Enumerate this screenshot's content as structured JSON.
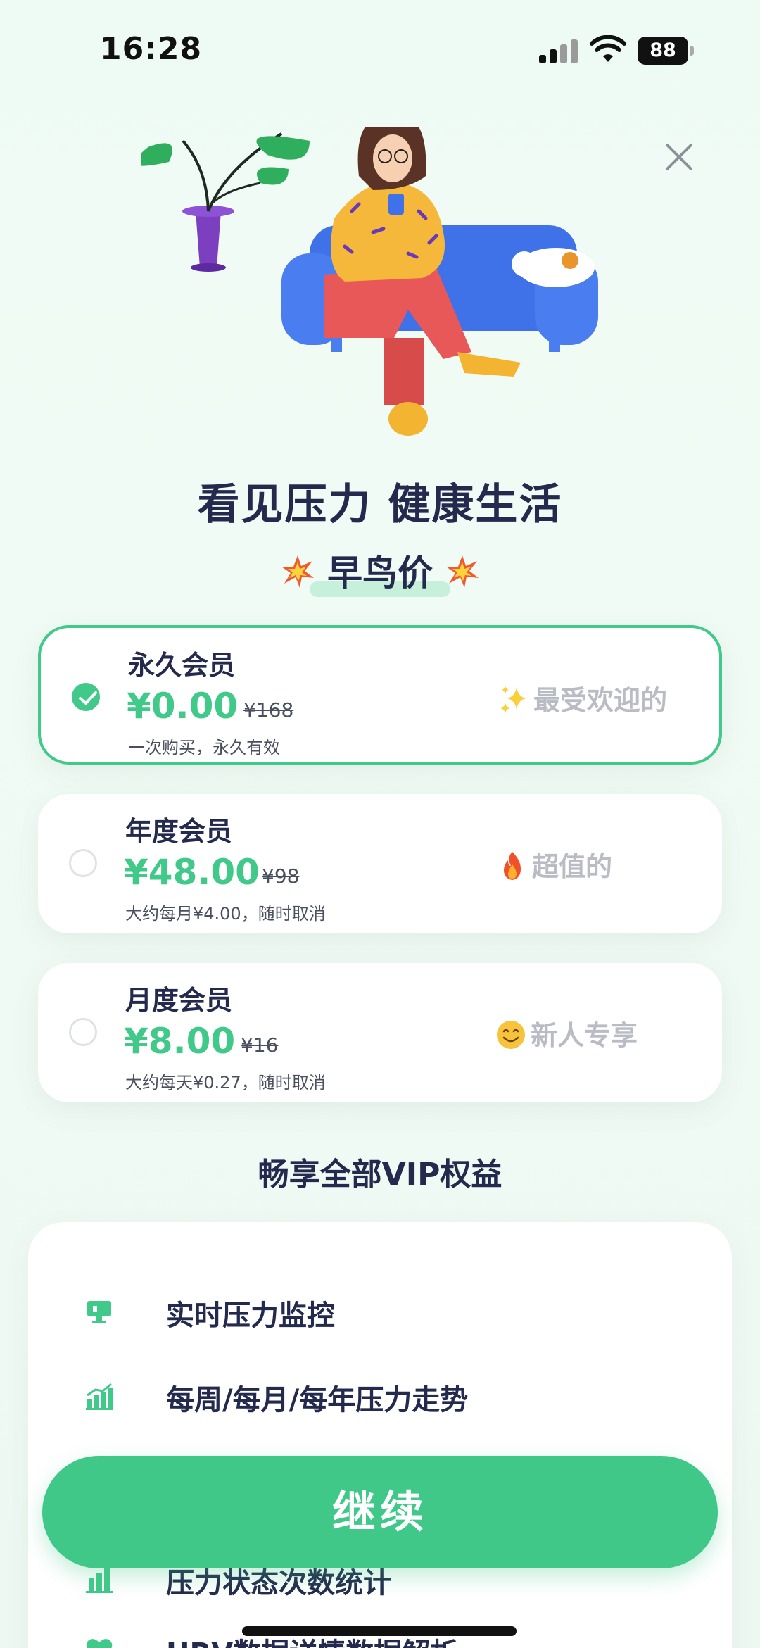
{
  "status_bar": {
    "time": "16:28",
    "battery": "88"
  },
  "header": {
    "headline": "看见压力 健康生活",
    "promo": "早鸟价"
  },
  "plans": [
    {
      "name": "永久会员",
      "price": "¥0.00",
      "original_price": "¥168",
      "description": "一次购买，永久有效",
      "tag": "最受欢迎的",
      "tag_icon": "sparkles-icon",
      "selected": true
    },
    {
      "name": "年度会员",
      "price": "¥48.00",
      "original_price": "¥98",
      "description": "大约每月¥4.00，随时取消",
      "tag": "超值的",
      "tag_icon": "fire-icon",
      "selected": false
    },
    {
      "name": "月度会员",
      "price": "¥8.00",
      "original_price": "¥16",
      "description": "大约每天¥0.27，随时取消",
      "tag": "新人专享",
      "tag_icon": "smile-icon",
      "selected": false
    }
  ],
  "benefits": {
    "title": "畅享全部VIP权益",
    "items": [
      {
        "label": "实时压力监控",
        "icon": "monitor-icon"
      },
      {
        "label": "每周/每月/每年压力走势",
        "icon": "trend-chart-icon"
      },
      {
        "label": "压力状态次数统计",
        "icon": "bar-chart-icon"
      },
      {
        "label": "HRV数据详情数据解析",
        "icon": "heart-icon"
      }
    ]
  },
  "cta": {
    "label": "继续"
  },
  "colors": {
    "accent": "#41c98a",
    "text": "#232a4d",
    "muted_tag": "#b9bcc4"
  }
}
